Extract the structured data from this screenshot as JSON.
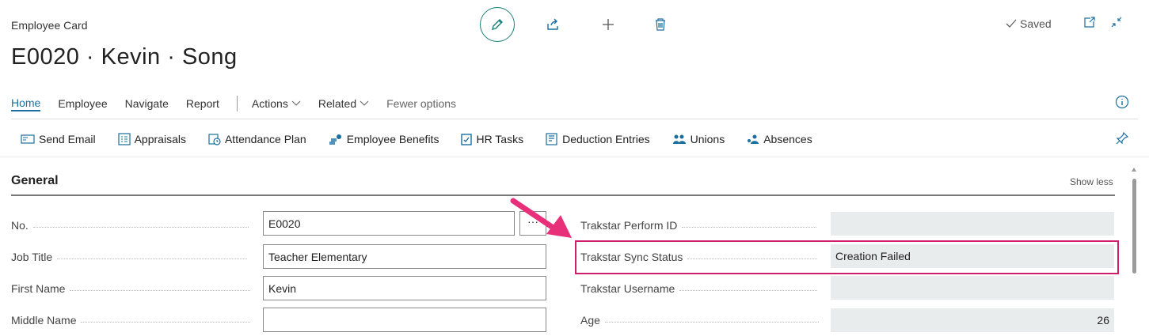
{
  "header": {
    "caption": "Employee Card",
    "title": "E0020 · Kevin · Song",
    "saved_label": "Saved"
  },
  "menu": {
    "items": [
      "Home",
      "Employee",
      "Navigate",
      "Report"
    ],
    "dropdowns": [
      "Actions",
      "Related"
    ],
    "fewer_options": "Fewer options"
  },
  "actions": {
    "items": [
      "Send Email",
      "Appraisals",
      "Attendance Plan",
      "Employee Benefits",
      "HR Tasks",
      "Deduction Entries",
      "Unions",
      "Absences"
    ]
  },
  "section": {
    "title": "General",
    "show_less": "Show less"
  },
  "left_fields": [
    {
      "label": "No.",
      "value": "E0020"
    },
    {
      "label": "Job Title",
      "value": "Teacher Elementary"
    },
    {
      "label": "First Name",
      "value": "Kevin"
    },
    {
      "label": "Middle Name",
      "value": ""
    }
  ],
  "right_fields": [
    {
      "label": "Trakstar Perform ID",
      "value": ""
    },
    {
      "label": "Trakstar Sync Status",
      "value": "Creation Failed"
    },
    {
      "label": "Trakstar Username",
      "value": ""
    },
    {
      "label": "Age",
      "value": "26"
    }
  ],
  "lookup_button": "···",
  "colors": {
    "accent": "#1a6fa0",
    "edit_ring": "#1a7f7a",
    "highlight": "#cf1d6b"
  }
}
